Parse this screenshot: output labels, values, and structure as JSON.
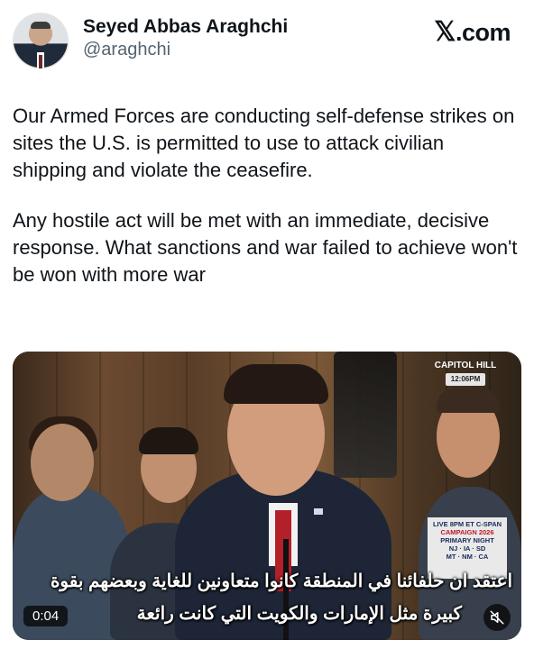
{
  "header": {
    "display_name": "Seyed Abbas Araghchi",
    "handle": "@araghchi",
    "brand": ".com",
    "brand_icon": "x-logo-icon"
  },
  "tweet": {
    "paragraphs": [
      "Our Armed Forces are conducting self-defense strikes on sites the U.S. is permitted to use to attack civilian shipping and violate the ceasefire.",
      "Any hostile act will be met with an immediate, decisive response. What sanctions and war failed to achieve won't be won with more war"
    ]
  },
  "video": {
    "overlay_top": [
      "CAPITOL HILL",
      "12:06PM"
    ],
    "overlay_box": [
      "LIVE 8PM ET C-SPAN",
      "CAMPAIGN 2026",
      "PRIMARY NIGHT",
      "NJ · IA · SD",
      "MT · NM · CA"
    ],
    "subtitle_lines": [
      "اعتقد ان حلفائنا في المنطقة كانوا متعاونين للغاية وبعضهم بقوة",
      "كبيرة مثل الإمارات والكويت التي كانت رائعة"
    ],
    "timestamp": "0:04",
    "mute_icon": "mute-icon"
  }
}
